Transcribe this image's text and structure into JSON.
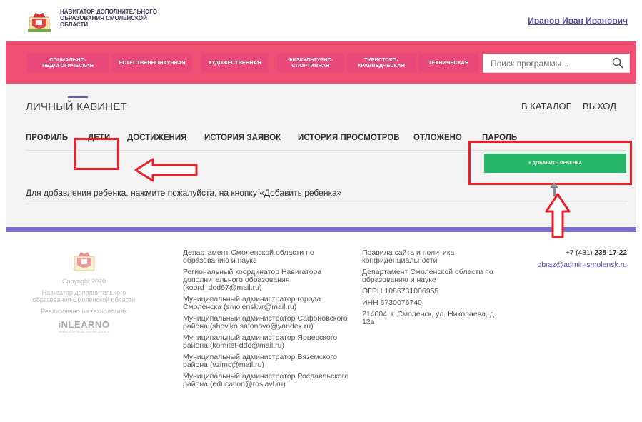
{
  "header": {
    "logo_lines": [
      "НАВИГАТОР ДОПОЛНИТЕЛЬНОГО",
      "ОБРАЗОВАНИЯ СМОЛЕНСКОЙ",
      "ОБЛАСТИ"
    ],
    "user_name": "Иванов Иван Иванович"
  },
  "nav": {
    "items": [
      {
        "label": "СОЦИАЛЬНО-ПЕДАГОГИЧЕСКАЯ"
      },
      {
        "label": "ЕСТЕСТВЕННОНАУЧНАЯ"
      },
      {
        "label": "ХУДОЖЕСТВЕННАЯ"
      },
      {
        "label": "ФИЗКУЛЬТУРНО-СПОРТИВНАЯ"
      },
      {
        "label": "ТУРИСТСКО-КРАЕВЕДЧЕСКАЯ"
      },
      {
        "label": "ТЕХНИЧЕСКАЯ"
      }
    ],
    "search_placeholder": "Поиск программы...",
    "search_icon": "search-icon"
  },
  "cabinet": {
    "title": "ЛИЧНЫЙ КАБИНЕТ",
    "catalog_link": "В КАТАЛОГ",
    "logout_link": "ВЫХОД",
    "tabs": [
      {
        "label": "ПРОФИЛЬ"
      },
      {
        "label": "ДЕТИ"
      },
      {
        "label": "ДОСТИЖЕНИЯ"
      },
      {
        "label": "ИСТОРИЯ ЗАЯВОК"
      },
      {
        "label": "ИСТОРИЯ ПРОСМОТРОВ"
      },
      {
        "label": "ОТЛОЖЕНО"
      },
      {
        "label": "ПАРОЛЬ"
      }
    ],
    "active_tab": "ДЕТИ",
    "add_button": "+ ДОБАВИТЬ РЕБЕНКА",
    "hint": "Для добавления ребенка, нажмите пожалуйста, на кнопку «Добавить ребенка»"
  },
  "footer": {
    "copyright": "Copyright 2020",
    "org": "Навигатор дополнительного образования Смоленской области",
    "tech": "Реализовано на технологиях",
    "tech_brand": "iNLEARNO",
    "tech_brand_sub": "НАВИГАТОР ПО ДЕТСКОМУ ДОСУГУ",
    "col2": [
      "Департамент Смоленской области по образованию и науке",
      "Региональный координатор Навигатора дополнительного образования (koord_dod67@mail.ru)",
      "Муниципальный администратор города Смоленска (smolenskvr@mail.ru)",
      "Муниципальный администратор Сафоновского района (shov.ko.safonovo@yandex.ru)",
      "Муниципальный администратор Ярцевского района (komitet-ddo@mail.ru)",
      "Муниципальный администратор Вяземского района (vzimc@mail.ru)",
      "Муниципальный администратор Рославльского района (education@roslavl.ru)"
    ],
    "col3": [
      "Правила сайта и политика конфиденциальности",
      "Департамент Смоленской области по образованию и науке",
      "ОГРН 1086731006955",
      "ИНН 6730076740",
      "214004, г. Смоленск, ул. Николаева, д. 12а"
    ],
    "phone_prefix": "+7 (481) ",
    "phone_number": "238-17-22",
    "email": "obraz@admin-smolensk.ru"
  },
  "colors": {
    "navbar": "#f04e73",
    "accent_purple": "#7a6fd0",
    "add_button": "#27b667",
    "annotation_red": "#e8202a"
  }
}
